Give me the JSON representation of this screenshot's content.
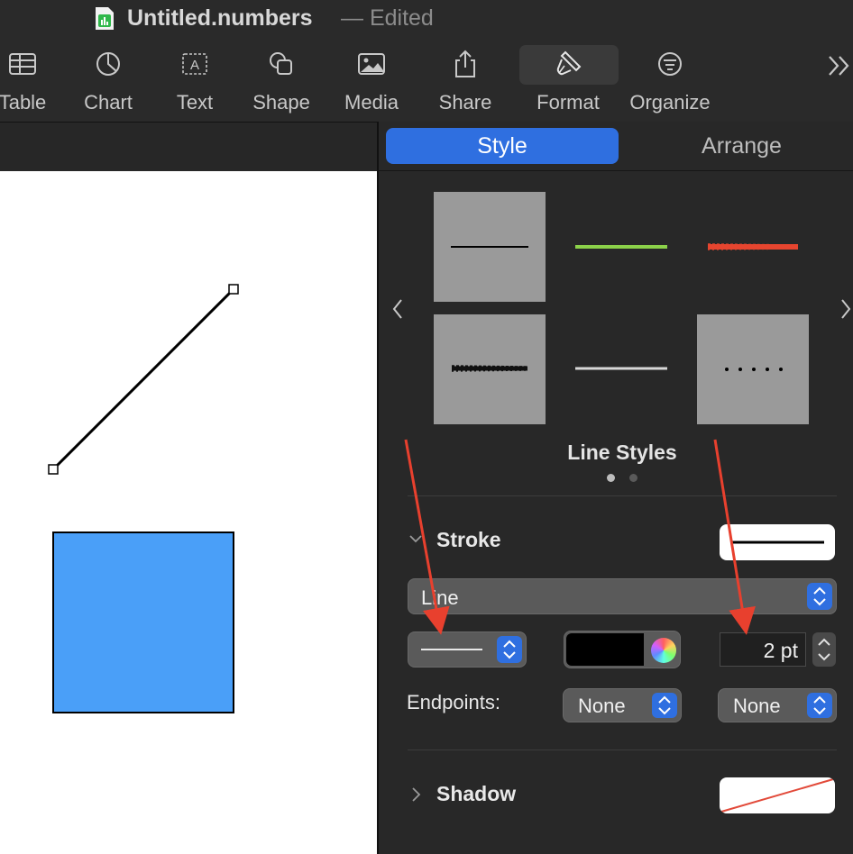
{
  "window": {
    "title": "Untitled.numbers",
    "status": "— Edited"
  },
  "toolbar": {
    "items": [
      {
        "label": "Table",
        "icon": "table-icon"
      },
      {
        "label": "Chart",
        "icon": "chart-icon"
      },
      {
        "label": "Text",
        "icon": "text-icon"
      },
      {
        "label": "Shape",
        "icon": "shape-icon"
      },
      {
        "label": "Media",
        "icon": "media-icon"
      },
      {
        "label": "Share",
        "icon": "share-icon"
      },
      {
        "label": "Format",
        "icon": "format-brush-icon"
      },
      {
        "label": "Organize",
        "icon": "organize-icon"
      }
    ],
    "more_icon": "double-chevron-right-icon"
  },
  "inspector": {
    "tabs": {
      "style": "Style",
      "arrange": "Arrange"
    },
    "line_styles": {
      "title": "Line Styles",
      "page_count": 2,
      "current_page": 1
    },
    "stroke": {
      "title": "Stroke",
      "type": "Line",
      "width_value": "2 pt",
      "color": "#000000",
      "endpoints_label": "Endpoints:",
      "endpoint_start": "None",
      "endpoint_end": "None"
    },
    "shadow": {
      "title": "Shadow"
    }
  },
  "canvas": {
    "shape_fill": "#4a9ff8"
  },
  "colors": {
    "accent": "#2f6fe0",
    "annotation": "#e8402e"
  }
}
